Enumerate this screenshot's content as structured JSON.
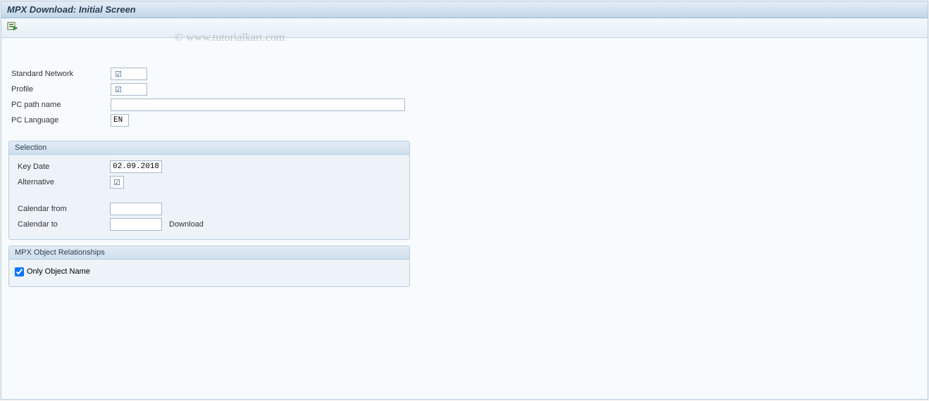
{
  "header": {
    "title": "MPX Download: Initial Screen",
    "watermark": "© www.tutorialkart.com"
  },
  "toolbar": {
    "execute_icon": "execute-icon"
  },
  "fields": {
    "standard_network": {
      "label": "Standard Network",
      "value": "",
      "required": true
    },
    "profile": {
      "label": "Profile",
      "value": "",
      "required": true
    },
    "pc_path": {
      "label": "PC path name",
      "value": ""
    },
    "pc_language": {
      "label": "PC Language",
      "value": "EN"
    }
  },
  "selection": {
    "title": "Selection",
    "key_date": {
      "label": "Key Date",
      "value": "02.09.2018"
    },
    "alternative": {
      "label": "Alternative",
      "value": "",
      "required": true
    },
    "calendar_from": {
      "label": "Calendar from",
      "value": ""
    },
    "calendar_to": {
      "label": "Calendar to",
      "value": "",
      "suffix": "Download"
    }
  },
  "relationships": {
    "title": "MPX Object Relationships",
    "only_object_name": {
      "label": "Only Object Name",
      "checked": true
    }
  }
}
